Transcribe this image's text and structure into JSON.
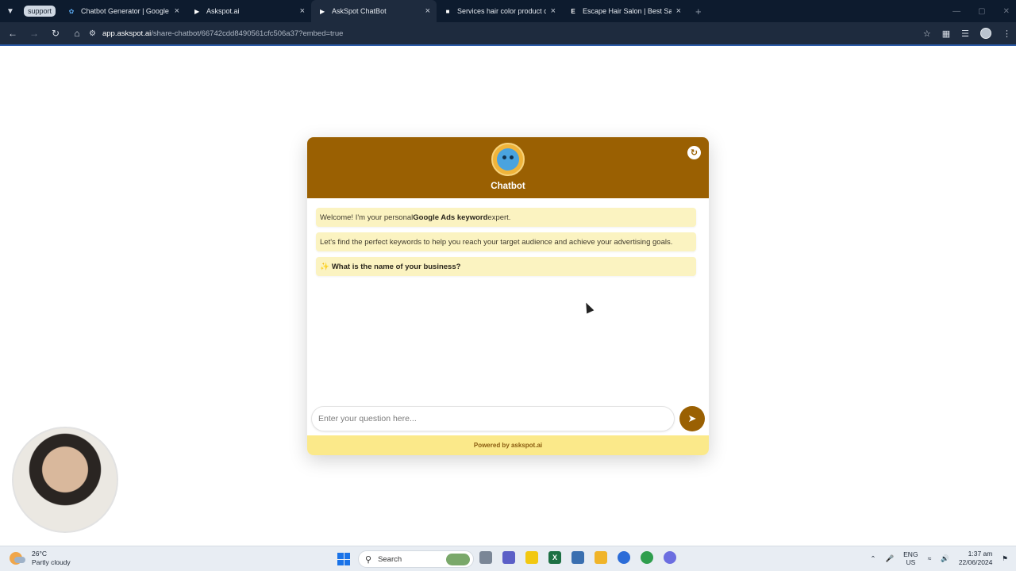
{
  "browser": {
    "tab_group_label": "support",
    "tabs": [
      {
        "title": "Chatbot Generator | Google AI",
        "icon": "butterfly-icon",
        "active": false
      },
      {
        "title": "Askspot.ai",
        "icon": "askspot-icon",
        "active": false
      },
      {
        "title": "AskSpot ChatBot",
        "icon": "askspot-icon",
        "active": true
      },
      {
        "title": "Services hair color product colo",
        "icon": "site-icon",
        "active": false
      },
      {
        "title": "Escape Hair Salon | Best San Di",
        "icon": "letter-e-icon",
        "active": false
      }
    ],
    "new_tab_symbol": "+",
    "url_host": "app.askspot.ai",
    "url_path": "/share-chatbot/66742cdd8490561cfc506a37?embed=true"
  },
  "chatbot": {
    "title": "Chatbot",
    "header_color": "#9a6002",
    "messages": [
      {
        "before": "Welcome! I'm your personal ",
        "bold": "Google Ads keyword",
        "after": " expert."
      },
      {
        "text": "Let's find the perfect keywords to help you reach your target audience and achieve your advertising goals."
      },
      {
        "sparkle": "✨",
        "bold": "What is the name of your business?"
      }
    ],
    "input_placeholder": "Enter your question here...",
    "footer": "Powered by askspot.ai",
    "accent_color": "#fbe98a"
  },
  "taskbar": {
    "weather_temp": "26°C",
    "weather_desc": "Partly cloudy",
    "search_label": "Search",
    "language": "ENG",
    "region": "US",
    "time": "1:37 am",
    "date": "22/06/2024"
  }
}
